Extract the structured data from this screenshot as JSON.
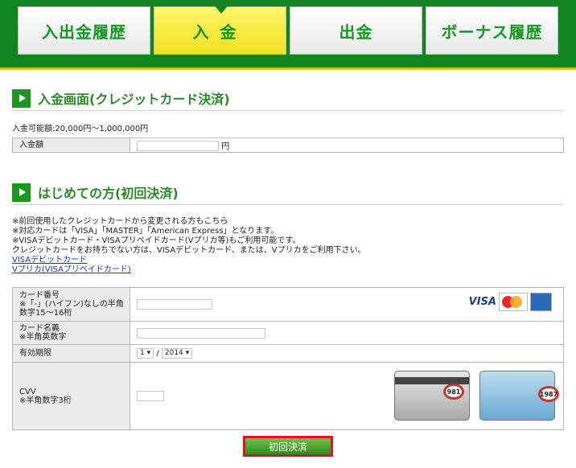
{
  "tabs": [
    {
      "label": "入出金履歴"
    },
    {
      "label": "入金"
    },
    {
      "label": "出金"
    },
    {
      "label": "ボーナス履歴"
    }
  ],
  "section1": {
    "title": "入金画面(クレジットカード決済)"
  },
  "deposit": {
    "range": "入金可能額:20,000円〜1,000,000円",
    "amount_label": "入金額",
    "unit": "円"
  },
  "section2": {
    "title": "はじめての方(初回決済)"
  },
  "notes": [
    "※前回使用したクレジットカードから変更される方もこちら",
    "※対応カードは「VISA」「MASTER」「American Express」となります。",
    "※VISAデビットカード・VISAプリペイドカード(Vプリカ等)もご利用可能です。",
    "クレジットカードをお持ちでない方は、VISAデビットカード、または、Vプリカをご利用下さい。"
  ],
  "links": {
    "visa_debit": "VISAデビットカード",
    "vpreca": "Vプリカ(VISAプリペイドカード)"
  },
  "card_form": {
    "card_number_label": [
      "カード番号",
      "※「-」(ハイフン)なしの半角",
      "数字15〜16桁"
    ],
    "card_name_label": [
      "カード名義",
      "※半角英数字"
    ],
    "expiry_label": "有効期限",
    "expiry_month": "1",
    "expiry_sep": "/",
    "expiry_year": "2014",
    "cvv_label": [
      "CVV",
      "※半角数字3桁"
    ],
    "logos": {
      "visa": "VISA"
    },
    "cvv_examples": [
      "981",
      "1987"
    ]
  },
  "submit_label": "初回決済",
  "colors": {
    "brand_green": "#11851f",
    "tab_yellow": "#f1df21",
    "accent_red": "#ea0d1b"
  }
}
